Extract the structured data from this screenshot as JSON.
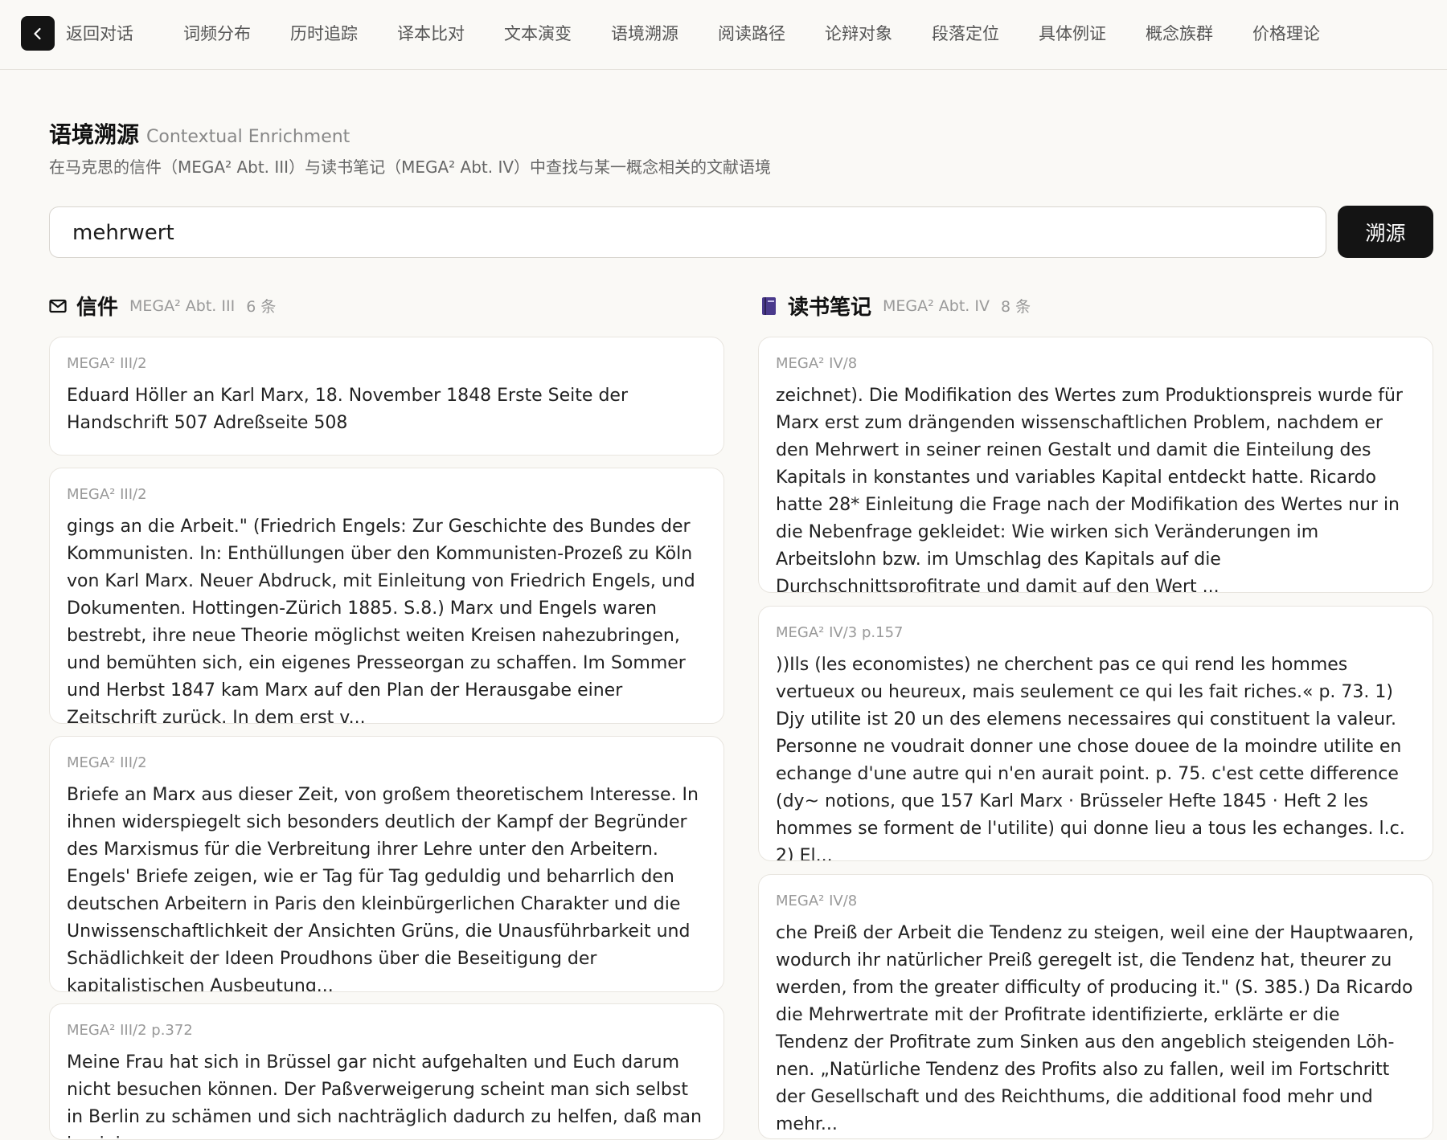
{
  "topbar": {
    "back_label": "返回对话",
    "nav": [
      "词频分布",
      "历时追踪",
      "译本比对",
      "文本演变",
      "语境溯源",
      "阅读路径",
      "论辩对象",
      "段落定位",
      "具体例证",
      "概念族群",
      "价格理论"
    ]
  },
  "page": {
    "title": "语境溯源",
    "subtitle": "Contextual Enrichment",
    "description": "在马克思的信件（MEGA² Abt. III）与读书笔记（MEGA² Abt. IV）中查找与某一概念相关的文献语境"
  },
  "search": {
    "value": "mehrwert",
    "button": "溯源"
  },
  "letters": {
    "title": "信件",
    "meta": "MEGA² Abt. III",
    "count": "6 条",
    "icon": "mail-icon",
    "cards": [
      {
        "source": "MEGA² III/2",
        "text": "Eduard Höller an Karl Marx, 18. November 1848 Erste Seite der Handschrift 507 Adreßseite 508"
      },
      {
        "source": "MEGA² III/2",
        "text": "gings an die Arbeit.\" (Friedrich Engels: Zur Geschichte des Bundes der Kommunisten. In: Enthüllungen über den Kommunisten-Prozeß zu Köln von Karl Marx. Neuer Abdruck, mit Einleitung von Friedrich Engels, und Dokumenten. Hottingen-Zürich 1885. S.8.) Marx und Engels waren bestrebt, ihre neue Theorie möglichst weiten Kreisen nahezubringen, und bemühten sich, ein eigenes Presseorgan zu schaffen. Im Sommer und Herbst 1847 kam Marx auf den Plan der Herausgabe einer Zeitschrift zurück. In dem erst v..."
      },
      {
        "source": "MEGA² III/2",
        "text": "Briefe an Marx aus dieser Zeit, von großem theoretischem Interesse. In ihnen widerspiegelt sich besonders deutlich der Kampf der Begründer des Marxismus für die Verbreitung ihrer Lehre unter den Arbeitern. Engels' Briefe zeigen, wie er Tag für Tag geduldig und beharrlich den deutschen Arbeitern in Paris den kleinbürgerlichen Charakter und die Unwissenschaftlichkeit der Ansichten Grüns, die Unausführbarkeit und Schädlichkeit der Ideen Proudhons über die Beseitigung der kapitalistischen Ausbeutung..."
      },
      {
        "source": "MEGA² III/2 p.372",
        "text": "Meine Frau hat sich in Brüssel gar nicht aufgehalten und Euch darum nicht besuchen können. Der Paßverweigerung scheint man sich selbst in Berlin zu schämen und sich nachträglich dadurch zu helfen, daß man in einigen"
      }
    ]
  },
  "notes": {
    "title": "读书笔记",
    "meta": "MEGA² Abt. IV",
    "count": "8 条",
    "icon": "book-icon",
    "cards": [
      {
        "source": "MEGA² IV/8",
        "text": "zeichnet). Die Modifikation des Wertes zum Produktionspreis wurde für Marx erst zum drängenden wissenschaftlichen Problem, nachdem er den Mehrwert in seiner reinen Gestalt und damit die Einteilung des Kapitals in konstantes und variables Kapital entdeckt hatte. Ricardo hatte 28* Einleitung die Frage nach der Modifikation des Wertes nur in die Nebenfrage gekleidet: Wie wirken sich Veränderungen im Arbeitslohn bzw. im Umschlag des Kapitals auf die Durchschnittsprofitrate und damit auf den Wert ..."
      },
      {
        "source": "MEGA² IV/3 p.157",
        "text": "))Ils (les economistes) ne cherchent pas ce qui rend les hommes vertueux ou heureux, mais seulement ce qui les fait riches.« p. 73. 1) Djy utilite ist 20 un des elemens necessaires qui constituent la valeur. Personne ne voudrait donner une chose douee de la moindre utilite en echange d'une autre qui n'en aurait point. p. 75. c'est cette difference (dy~ notions, que 157 Karl Marx · Brüsseler Hefte 1845 · Heft 2 les hommes se forment de l'utilite) qui donne lieu a tous les echanges. l.c. 2) El..."
      },
      {
        "source": "MEGA² IV/8",
        "text": "che Preiß der Arbeit die Tendenz zu steigen, weil eine der Hauptwaaren, wodurch ihr natürlicher Preiß geregelt ist, die Tendenz hat, theurer zu werden, from the greater difficulty of producing it.\" (S. 385.) Da Ricardo die Mehrwertrate mit der Profitrate identifizierte, erklärte er die Tendenz der Profitrate zum Sinken aus den angeblich steigenden Löh- nen. „Natürliche Tendenz des Profits also zu fallen, weil im Fortschritt der Gesellschaft und des Reichthums, die additional food mehr und mehr..."
      }
    ]
  }
}
